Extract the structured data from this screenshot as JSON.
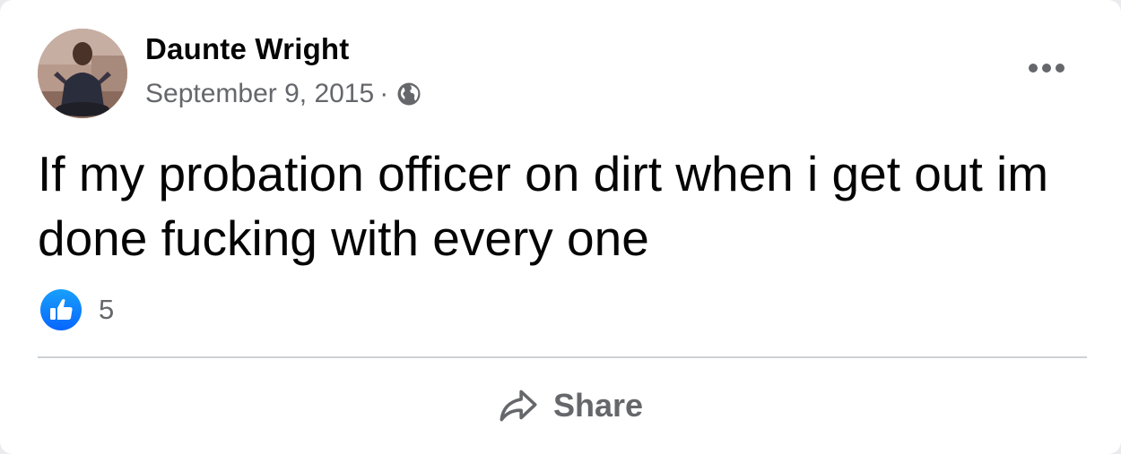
{
  "post": {
    "author": "Daunte Wright",
    "date": "September 9, 2015",
    "separator": "·",
    "privacy_icon": "globe-icon",
    "more_icon": "more-options-icon",
    "text": "If my probation officer on dirt when i get out im done fucking with every one",
    "reactions": {
      "icon": "like-icon",
      "count": "5"
    },
    "actions": {
      "share_label": "Share",
      "share_icon": "share-arrow-icon"
    }
  },
  "colors": {
    "card_bg": "#ffffff",
    "primary_text": "#050505",
    "secondary_text": "#65676b",
    "like_blue": "#1877f2",
    "divider": "#ced0d4"
  }
}
